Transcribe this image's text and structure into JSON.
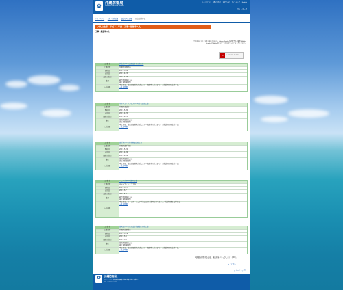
{
  "header": {
    "org": "沖縄防衛局",
    "org_sub": "Okinawa Defense Bureau",
    "nav": [
      "トップページ",
      "お問い合わせ",
      "文字サイズ",
      "サイトマップ",
      "English"
    ],
    "sub": "サイトマップ"
  },
  "breadcrumb": [
    "トップページ",
    "入札・契約情報",
    "過去の入札情報",
    "入札公告等一覧"
  ],
  "page_title": "入札公告等　平成３１年度　工事一般競争入札",
  "section_title": "工事一般競争入札",
  "note": "下記のPDFファイルをご覧になるには、Adobe Readerが必要です。最新のAdobe Readerは Adobe社 のページからダウンロードしてください。",
  "pdf_button": "Get ADOBE READER",
  "keys": [
    "工 事 名",
    "工事場所",
    "開札日",
    "公告日",
    "最終公告日",
    "備考",
    "入札概要"
  ],
  "blocks": [
    {
      "name": "伊佐浜(H31)道路改修その他工事",
      "place": "沖縄県宜野湾市",
      "d1": "2019.5.16",
      "d2": "2019.4.23",
      "d3": "2019.4.23",
      "note1": "総合評価落札方式",
      "note2": "施工体制確認型",
      "desc": "本工事は、総合評価落札方式による一般競争入札であり、入札説明書を交付する。",
      "link": "入札説明書"
    },
    {
      "name": "キャンプ・ハンセン(H31)庁舎改修工事",
      "place": "沖縄県金武町",
      "d1": "2019.5.20",
      "d2": "2019.4.25",
      "d3": "2019.4.25",
      "note1": "総合評価落札方式",
      "note2": "施工体制確認型",
      "desc": "本工事は、総合評価落札方式による一般競争入札であり、入札説明書を交付する。",
      "link": "入札説明書"
    },
    {
      "name": "嘉手納(H31)排水施設改修工事",
      "place": "沖縄県嘉手納町",
      "d1": "2019.5.22",
      "d2": "2019.4.26",
      "d3": "2019.4.26",
      "note1": "総合評価落札方式",
      "note2": "施工体制確認型",
      "desc": "本工事は、総合評価落札方式による一般競争入札であり、入札説明書を交付する。",
      "link": "入札説明書"
    },
    {
      "name": "シュワブ(H31)護岸工事",
      "place": "キャンプ・シュワブ内",
      "d1": "2019.5.27",
      "d2": "2019.5.7",
      "d3": "2019.5.7",
      "note1": "総合評価落札方式",
      "note2": "施工体制確認型",
      "desc": "本工事は、キャンプ・シュワブ内における護岸工事であり、入札説明書を交付する。",
      "link": "入札説明書"
    },
    {
      "name": "普天間(H31)庁舎改修等建築その他工事",
      "place": "沖縄県宜野湾市",
      "d1": "2019.5.29",
      "d2": "2019.5.9",
      "d3": "2019.5.9",
      "note1": "総合評価落札方式",
      "note2": "施工体制確認型",
      "desc": "本工事は、総合評価落札方式による一般競争入札であり、入札説明書を交付する。",
      "link": "入札説明書"
    }
  ],
  "bottom_text": "※詳細を参照するには、画面左をクリックします（PDF）。",
  "page_top": "▲ 上に戻る",
  "footer": {
    "name": "沖縄防衛局",
    "name_en": "Okinawa Defense Bureau",
    "addr": "〒904-0295 沖縄県中頭郡嘉手納町字嘉手納290番地9",
    "tel": "TEL 098-921-8131",
    "top": "▲ ページトップへ"
  }
}
